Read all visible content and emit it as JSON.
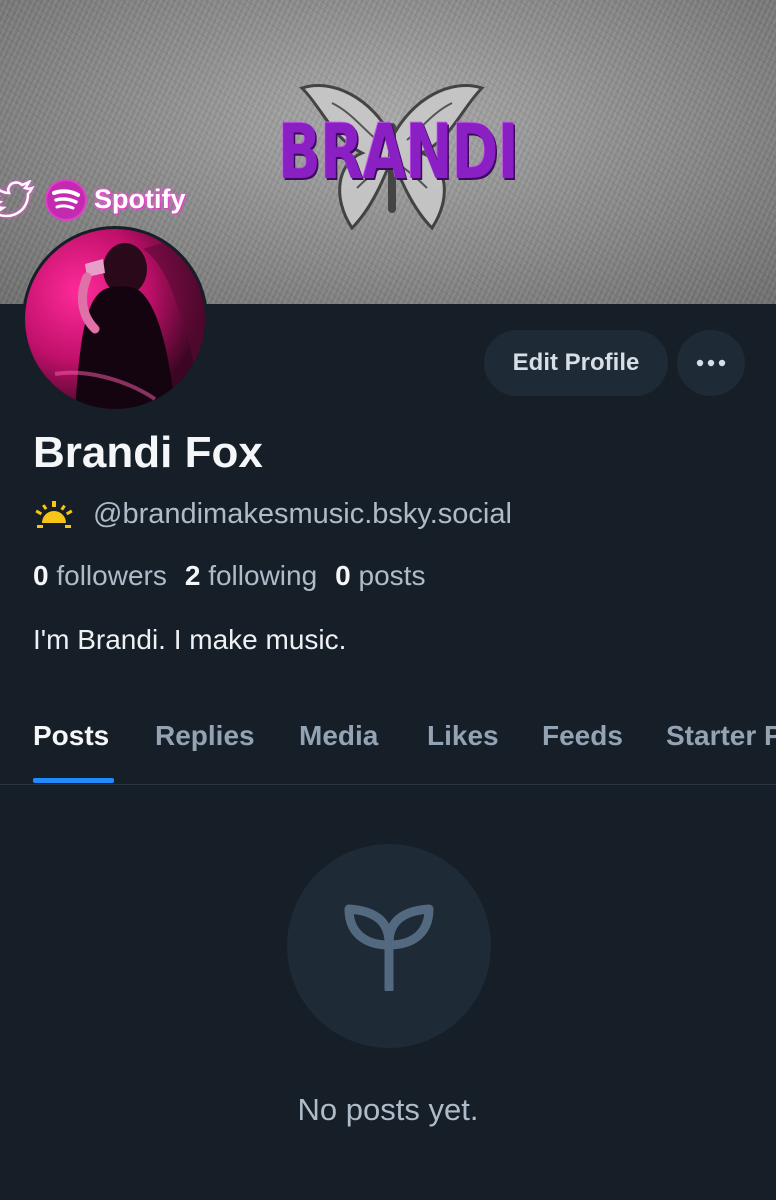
{
  "banner": {
    "logo_text": "BRANDI",
    "spotify_label": "Spotify"
  },
  "profile": {
    "display_name": "Brandi Fox",
    "handle": "@brandimakesmusic.bsky.social",
    "bio": "I'm Brandi. I make music.",
    "stats": {
      "followers_count": "0",
      "followers_label": "followers",
      "following_count": "2",
      "following_label": "following",
      "posts_count": "0",
      "posts_label": "posts"
    }
  },
  "actions": {
    "edit_label": "Edit Profile",
    "more_label": "•••"
  },
  "tabs": [
    {
      "label": "Posts",
      "active": true
    },
    {
      "label": "Replies",
      "active": false
    },
    {
      "label": "Media",
      "active": false
    },
    {
      "label": "Likes",
      "active": false
    },
    {
      "label": "Feeds",
      "active": false
    },
    {
      "label": "Starter Packs",
      "active": false
    }
  ],
  "empty_state": {
    "message": "No posts yet.",
    "icon": "sprout-icon"
  },
  "colors": {
    "background": "#161e27",
    "accent": "#208bfe",
    "muted_text": "#aebbc9",
    "button_bg": "#1e2a36",
    "logo_purple": "#8a1fc4"
  }
}
